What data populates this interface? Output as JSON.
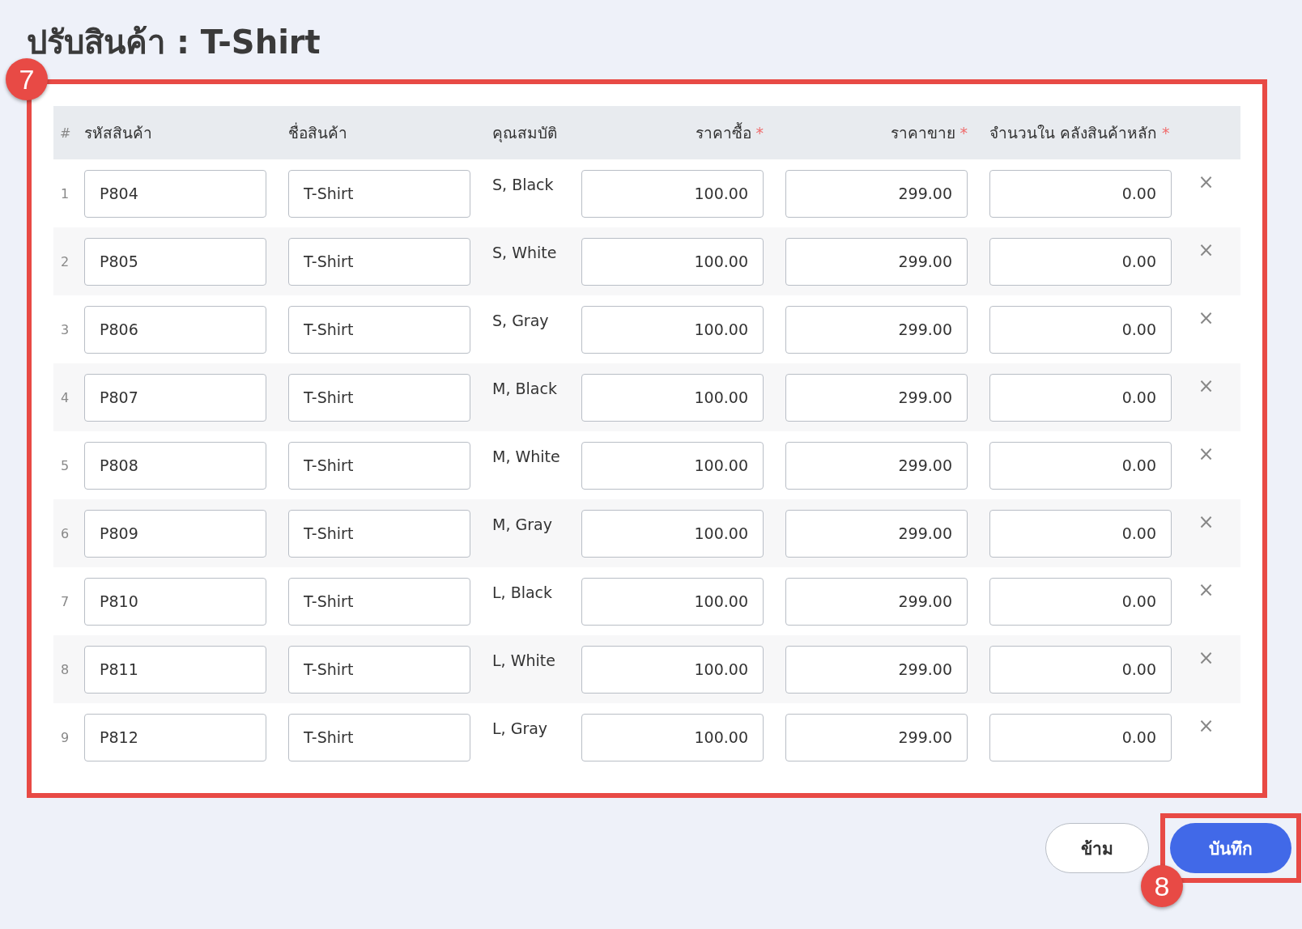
{
  "title": "ปรับสินค้า : T-Shirt",
  "table": {
    "callout": "7",
    "columns": [
      {
        "label": "#"
      },
      {
        "label": "รหัสสินค้า"
      },
      {
        "label": "ชื่อสินค้า"
      },
      {
        "label": "คุณสมบัติ"
      },
      {
        "label": "ราคาซื้อ",
        "required_mark": "*"
      },
      {
        "label": "ราคาขาย",
        "required_mark": "*"
      },
      {
        "label": "จำนวนใน คลังสินค้าหลัก",
        "required_mark": "*"
      }
    ],
    "rows": [
      {
        "index": "1",
        "code": "P804",
        "name": "T-Shirt",
        "attributes": "S, Black",
        "buy_price": "100.00",
        "sell_price": "299.00",
        "quantity": "0.00",
        "remove": "×"
      },
      {
        "index": "2",
        "code": "P805",
        "name": "T-Shirt",
        "attributes": "S, White",
        "buy_price": "100.00",
        "sell_price": "299.00",
        "quantity": "0.00",
        "remove": "×"
      },
      {
        "index": "3",
        "code": "P806",
        "name": "T-Shirt",
        "attributes": "S, Gray",
        "buy_price": "100.00",
        "sell_price": "299.00",
        "quantity": "0.00",
        "remove": "×"
      },
      {
        "index": "4",
        "code": "P807",
        "name": "T-Shirt",
        "attributes": "M, Black",
        "buy_price": "100.00",
        "sell_price": "299.00",
        "quantity": "0.00",
        "remove": "×"
      },
      {
        "index": "5",
        "code": "P808",
        "name": "T-Shirt",
        "attributes": "M, White",
        "buy_price": "100.00",
        "sell_price": "299.00",
        "quantity": "0.00",
        "remove": "×"
      },
      {
        "index": "6",
        "code": "P809",
        "name": "T-Shirt",
        "attributes": "M, Gray",
        "buy_price": "100.00",
        "sell_price": "299.00",
        "quantity": "0.00",
        "remove": "×"
      },
      {
        "index": "7",
        "code": "P810",
        "name": "T-Shirt",
        "attributes": "L, Black",
        "buy_price": "100.00",
        "sell_price": "299.00",
        "quantity": "0.00",
        "remove": "×"
      },
      {
        "index": "8",
        "code": "P811",
        "name": "T-Shirt",
        "attributes": "L, White",
        "buy_price": "100.00",
        "sell_price": "299.00",
        "quantity": "0.00",
        "remove": "×"
      },
      {
        "index": "9",
        "code": "P812",
        "name": "T-Shirt",
        "attributes": "L, Gray",
        "buy_price": "100.00",
        "sell_price": "299.00",
        "quantity": "0.00",
        "remove": "×"
      }
    ]
  },
  "buttons": [
    {
      "label": "ข้าม",
      "kind": "secondary"
    },
    {
      "label": "บันทึก",
      "kind": "primary",
      "callout": "8"
    }
  ]
}
